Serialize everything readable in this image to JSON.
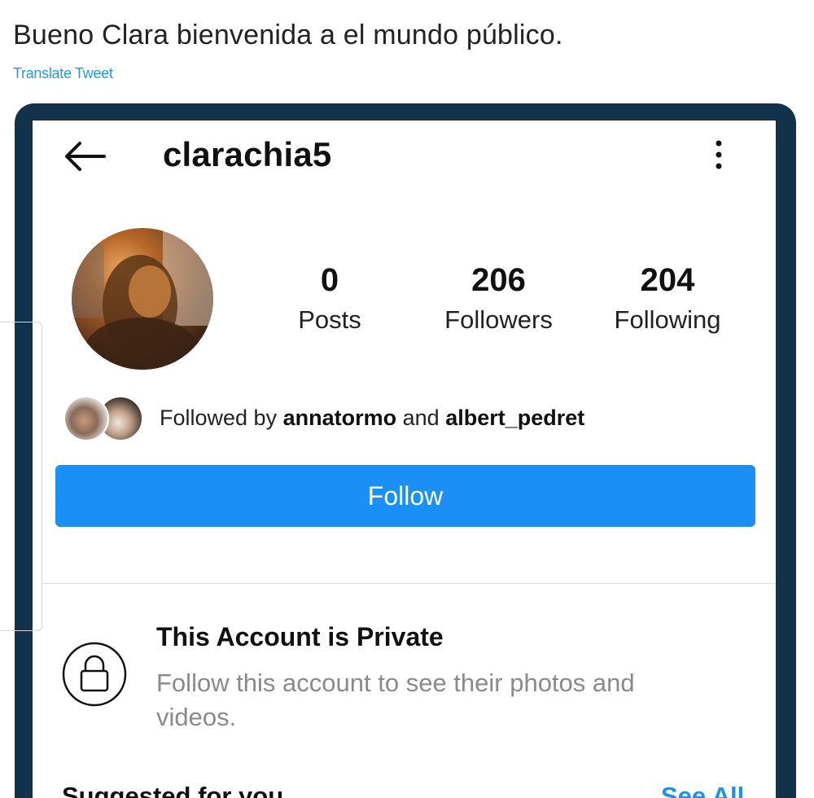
{
  "tweet": {
    "text": "Bueno Clara bienvenida a el mundo público.",
    "translate_label": "Translate Tweet"
  },
  "profile": {
    "username": "clarachia5",
    "stats": {
      "posts_value": "0",
      "posts_label": "Posts",
      "followers_value": "206",
      "followers_label": "Followers",
      "following_value": "204",
      "following_label": "Following"
    },
    "followed_by": {
      "prefix": "Followed by",
      "user1": "annatormo",
      "conjunction": "and",
      "user2": "albert_pedret"
    },
    "follow_button_label": "Follow",
    "private": {
      "title": "This Account is Private",
      "description": "Follow this account to see their photos and videos."
    },
    "suggested": {
      "title": "Suggested for you",
      "see_all_label": "See All"
    }
  },
  "colors": {
    "accent_blue": "#1a8ff5",
    "link_blue": "#1d9bf0",
    "frame": "#12314a",
    "muted_text": "#8a8a8a"
  },
  "icons": {
    "back": "arrow-left-icon",
    "more": "more-vertical-icon",
    "lock": "lock-icon"
  }
}
